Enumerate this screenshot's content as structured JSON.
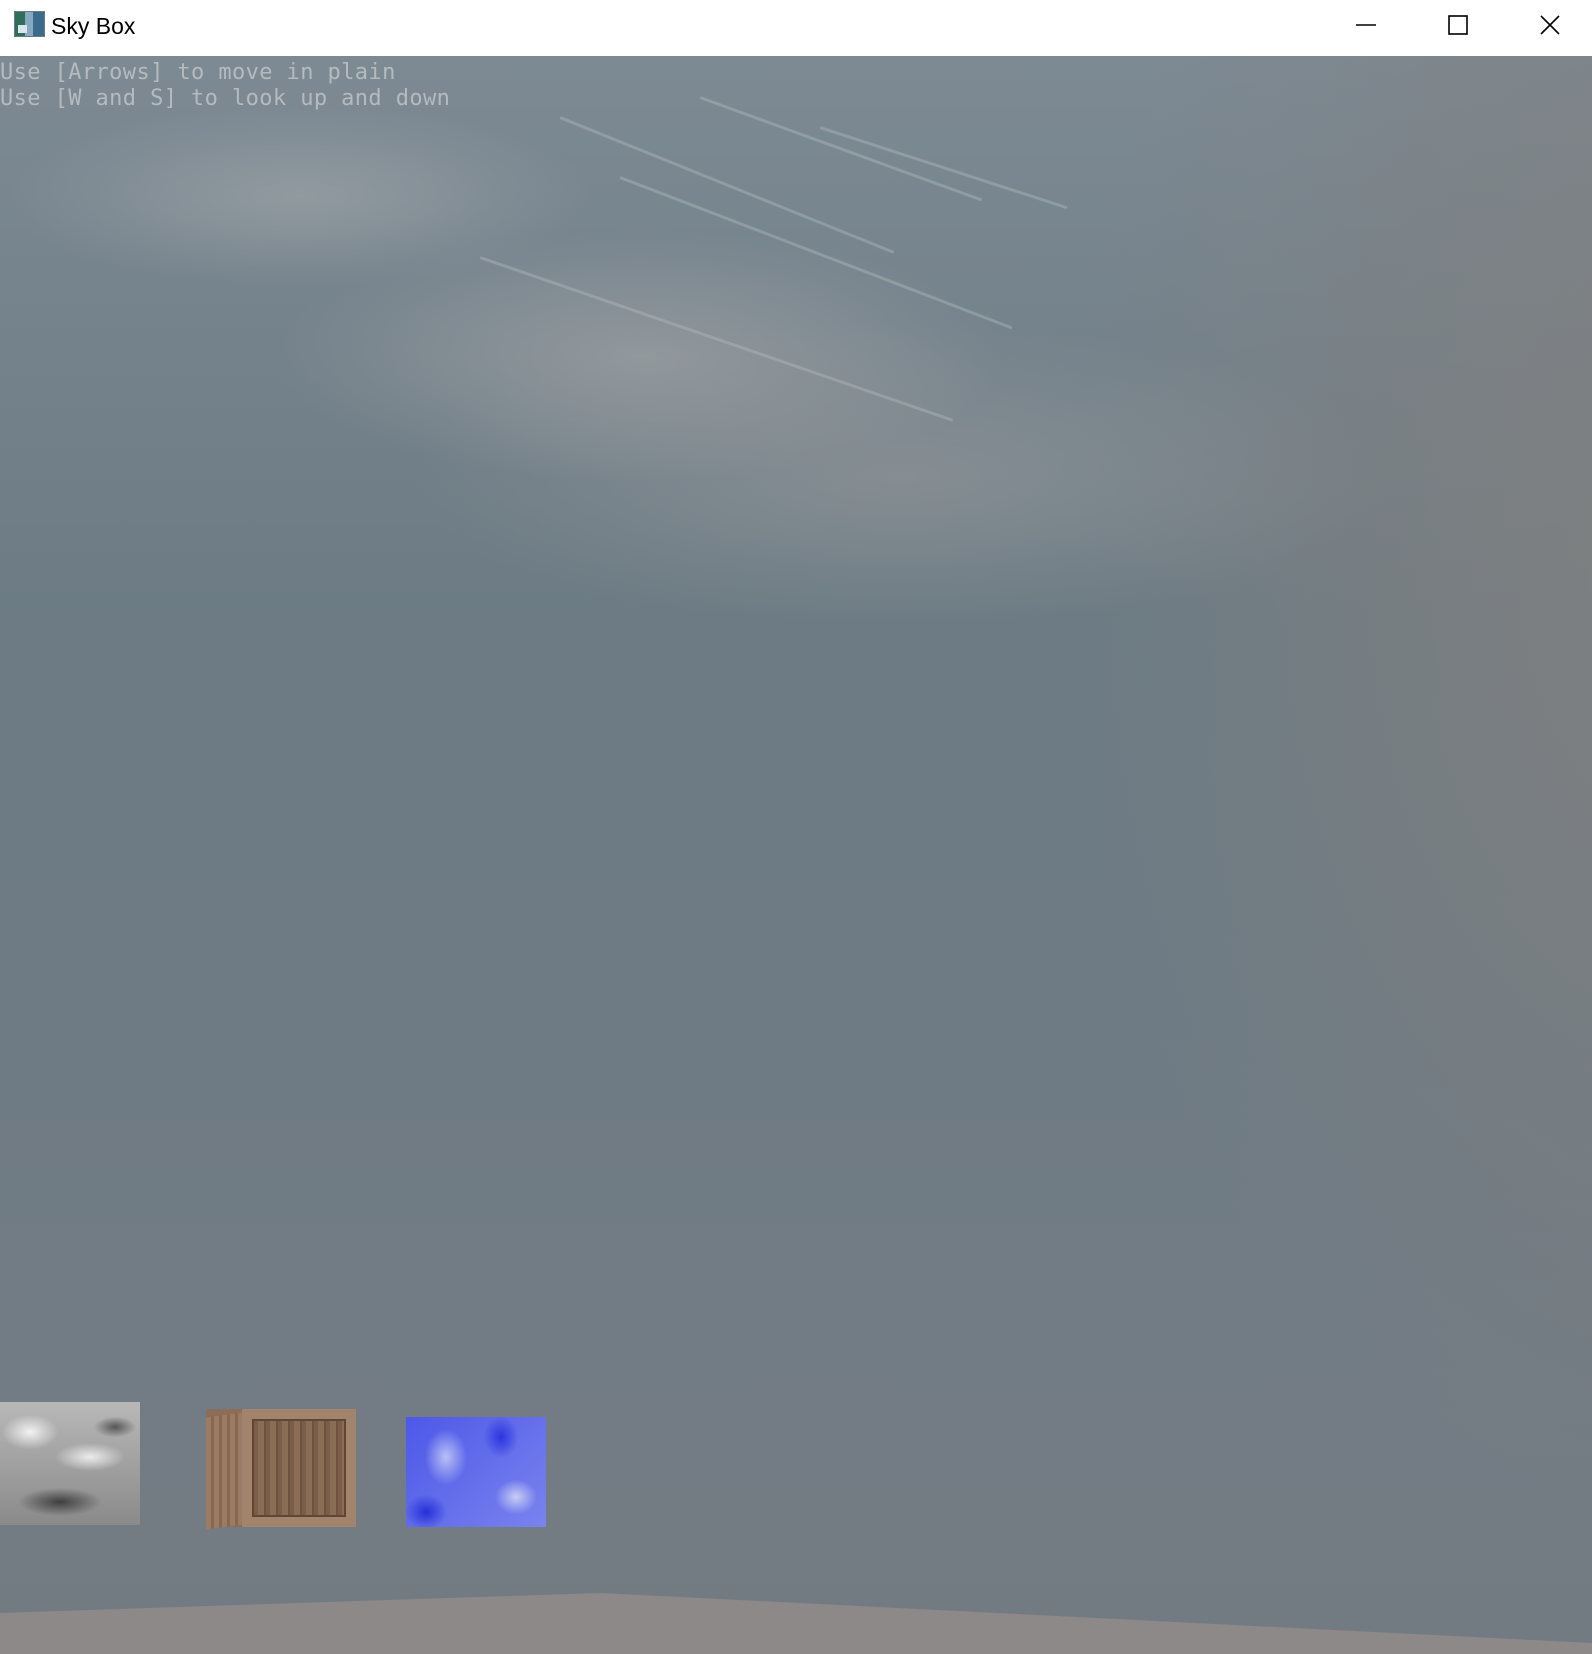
{
  "window": {
    "title": "Sky Box",
    "icon": "app-icon",
    "controls": {
      "minimize": "minimize-icon",
      "maximize": "maximize-icon",
      "close": "close-icon"
    }
  },
  "hud": {
    "line1": "Use [Arrows] to move in plain",
    "line2": "Use [W and S] to look up and down"
  },
  "scene": {
    "objects": [
      {
        "name": "gray-marble-cube",
        "color": "#9a9a9a"
      },
      {
        "name": "wooden-crate-cube",
        "color": "#8c6e58"
      },
      {
        "name": "blue-marble-cube",
        "color": "#4d58e8"
      }
    ],
    "sky_color": "#6e7b84",
    "ground_color": "#8e8a88"
  }
}
